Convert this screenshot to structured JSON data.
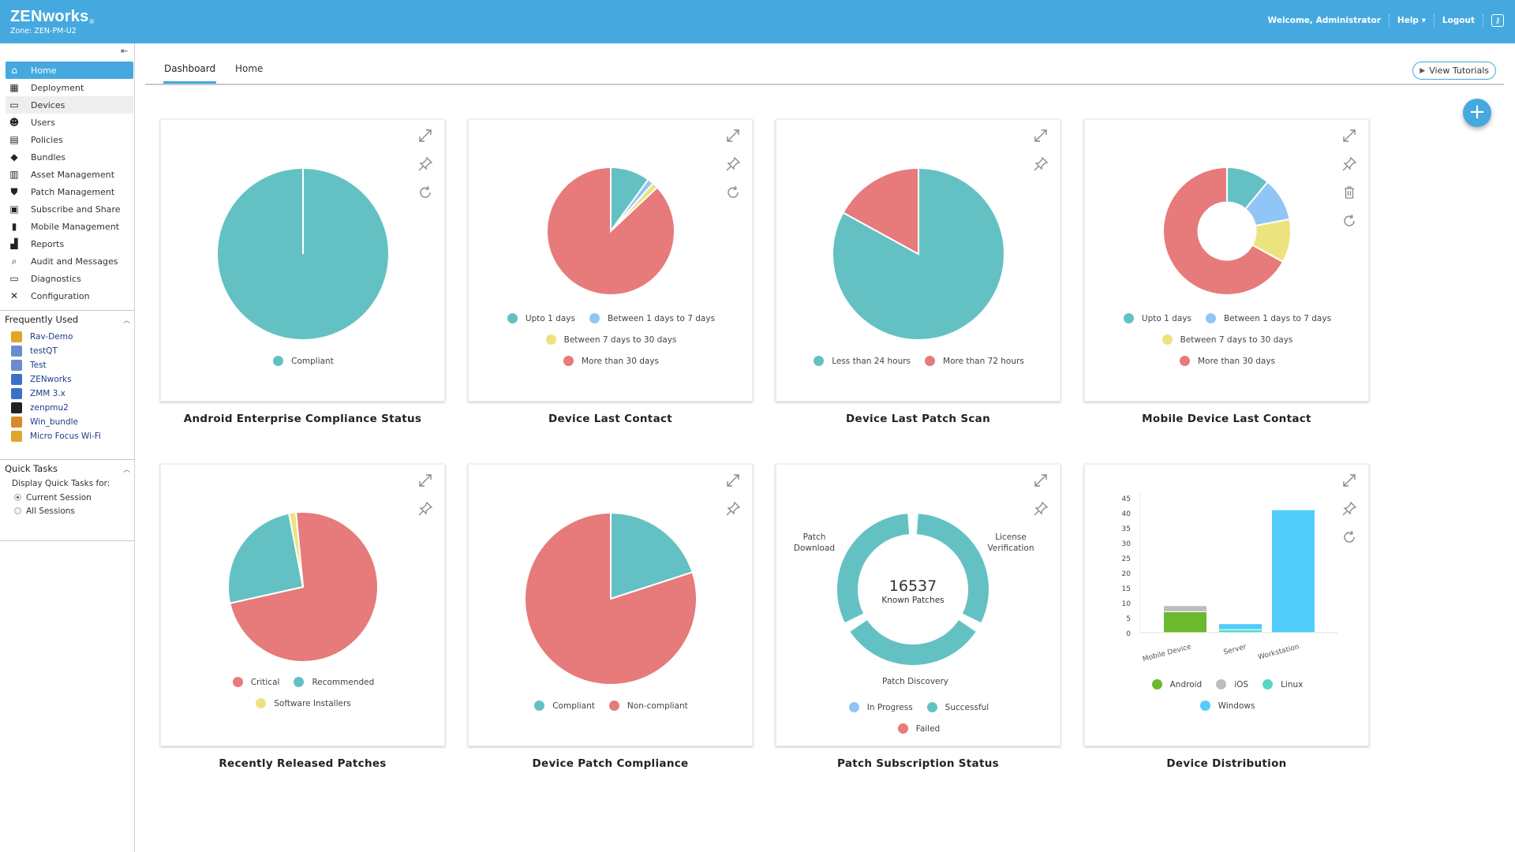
{
  "header": {
    "brand": "ZENworks",
    "brand_mark": "®",
    "zone": "Zone: ZEN-PM-U2",
    "welcome": "Welcome, Administrator",
    "help": "Help ▾",
    "logout": "Logout",
    "key_icon": "key-icon"
  },
  "sidebar": {
    "collapse_icon": "collapse-sidebar-icon",
    "items": [
      {
        "label": "Home",
        "icon": "home-icon",
        "glyph": "⌂",
        "active": true
      },
      {
        "label": "Deployment",
        "icon": "deployment-icon",
        "glyph": "▦"
      },
      {
        "label": "Devices",
        "icon": "monitor-icon",
        "glyph": "▭",
        "hover": true
      },
      {
        "label": "Users",
        "icon": "users-icon",
        "glyph": "☻"
      },
      {
        "label": "Policies",
        "icon": "policies-icon",
        "glyph": "▤"
      },
      {
        "label": "Bundles",
        "icon": "bundle-icon",
        "glyph": "◆"
      },
      {
        "label": "Asset Management",
        "icon": "asset-icon",
        "glyph": "▥"
      },
      {
        "label": "Patch Management",
        "icon": "shield-icon",
        "glyph": "⛊"
      },
      {
        "label": "Subscribe and Share",
        "icon": "subscribe-icon",
        "glyph": "▣"
      },
      {
        "label": "Mobile Management",
        "icon": "mobile-icon",
        "glyph": "▮"
      },
      {
        "label": "Reports",
        "icon": "reports-icon",
        "glyph": "▟"
      },
      {
        "label": "Audit and Messages",
        "icon": "search-icon",
        "glyph": "⌕"
      },
      {
        "label": "Diagnostics",
        "icon": "diagnostics-icon",
        "glyph": "▭"
      },
      {
        "label": "Configuration",
        "icon": "tools-icon",
        "glyph": "✕"
      }
    ],
    "frequently_used": {
      "title": "Frequently Used",
      "items": [
        {
          "label": "Rav-Demo",
          "icon": "wifi-bundle-icon",
          "color": "#e0a52a"
        },
        {
          "label": "testQT",
          "icon": "user-policy-icon",
          "color": "#6b8ccf"
        },
        {
          "label": "Test",
          "icon": "user-policy-icon",
          "color": "#6b8ccf"
        },
        {
          "label": "ZENworks",
          "icon": "mobile-bundle-icon",
          "color": "#3d6fc9"
        },
        {
          "label": "ZMM 3.x",
          "icon": "mobile-bundle-icon",
          "color": "#3d6fc9"
        },
        {
          "label": "zenpmu2",
          "icon": "server-icon",
          "color": "#222222"
        },
        {
          "label": "Win_bundle",
          "icon": "windows-bundle-icon",
          "color": "#d98b2b"
        },
        {
          "label": "Micro Focus Wi-Fi",
          "icon": "wifi-bundle-icon",
          "color": "#e0a52a"
        }
      ]
    },
    "quick_tasks": {
      "title": "Quick Tasks",
      "display_label": "Display Quick Tasks for:",
      "options": [
        {
          "label": "Current Session",
          "selected": true
        },
        {
          "label": "All Sessions",
          "selected": false
        }
      ]
    }
  },
  "tabs": [
    {
      "label": "Dashboard",
      "active": true
    },
    {
      "label": "Home",
      "active": false
    }
  ],
  "view_tutorials": "View Tutorials",
  "add_widget": "+",
  "colors": {
    "teal": "#64c1c3",
    "red": "#e77a7a",
    "blue": "#90c5f5",
    "yellow": "#ece37e",
    "green": "#6ab92e",
    "gray": "#bdbdbd",
    "linux": "#5ad6c6",
    "windows": "#52cdfb",
    "brand": "#45a9e0"
  },
  "chart_data": [
    {
      "id": "android-compliance",
      "type": "pie",
      "title": "Android Enterprise Compliance Status",
      "slices": [
        {
          "label": "Compliant",
          "value": 100,
          "color": "#64c1c3"
        }
      ],
      "legend": [
        [
          "Compliant"
        ]
      ],
      "tools": [
        "expand",
        "pin",
        "refresh"
      ]
    },
    {
      "id": "device-last-contact",
      "type": "pie",
      "title": "Device Last Contact",
      "slices": [
        {
          "label": "Upto 1 days",
          "value": 10,
          "color": "#64c1c3"
        },
        {
          "label": "Between 1 days to 7 days",
          "value": 1.5,
          "color": "#90c5f5"
        },
        {
          "label": "Between 7 days to 30 days",
          "value": 1.5,
          "color": "#ece37e"
        },
        {
          "label": "More than 30 days",
          "value": 87,
          "color": "#e77a7a"
        }
      ],
      "legend": [
        [
          "Upto 1 days",
          "Between 1 days to 7 days"
        ],
        [
          "Between 7 days to 30 days"
        ],
        [
          "More than 30 days"
        ]
      ],
      "tools": [
        "expand",
        "pin",
        "refresh"
      ]
    },
    {
      "id": "device-last-patch-scan",
      "type": "pie",
      "title": "Device Last Patch Scan",
      "slices": [
        {
          "label": "Less than 24 hours",
          "value": 83,
          "color": "#64c1c3"
        },
        {
          "label": "More than 72 hours",
          "value": 17,
          "color": "#e77a7a"
        }
      ],
      "legend": [
        [
          "Less than 24 hours",
          "More than 72 hours"
        ]
      ],
      "tools": [
        "expand",
        "pin"
      ]
    },
    {
      "id": "mobile-last-contact",
      "type": "donut",
      "title": "Mobile Device Last Contact",
      "slices": [
        {
          "label": "Upto 1 days",
          "value": 11,
          "color": "#64c1c3"
        },
        {
          "label": "Between 1 days to 7 days",
          "value": 11,
          "color": "#90c5f5"
        },
        {
          "label": "Between 7 days to 30 days",
          "value": 11,
          "color": "#ece37e"
        },
        {
          "label": "More than 30 days",
          "value": 67,
          "color": "#e77a7a"
        }
      ],
      "legend": [
        [
          "Upto 1 days",
          "Between 1 days to 7 days"
        ],
        [
          "Between 7 days to 30 days"
        ],
        [
          "More than 30 days"
        ]
      ],
      "tools": [
        "expand",
        "pin",
        "delete",
        "refresh"
      ]
    },
    {
      "id": "recently-released-patches",
      "type": "pie",
      "title": "Recently Released Patches",
      "slices": [
        {
          "label": "Critical",
          "value": 73,
          "color": "#e77a7a"
        },
        {
          "label": "Recommended",
          "value": 25.5,
          "color": "#64c1c3"
        },
        {
          "label": "Software Installers",
          "value": 1.5,
          "color": "#ece37e"
        }
      ],
      "start_offset": -1.5,
      "legend": [
        [
          "Critical",
          "Recommended"
        ],
        [
          "Software Installers"
        ]
      ],
      "tools": [
        "expand",
        "pin"
      ]
    },
    {
      "id": "device-patch-compliance",
      "type": "pie",
      "title": "Device Patch Compliance",
      "slices": [
        {
          "label": "Compliant",
          "value": 20,
          "color": "#64c1c3"
        },
        {
          "label": "Non-compliant",
          "value": 80,
          "color": "#e77a7a"
        }
      ],
      "legend": [
        [
          "Compliant",
          "Non-compliant"
        ]
      ],
      "tools": [
        "expand",
        "pin"
      ]
    },
    {
      "id": "patch-subscription-status",
      "type": "donut-segments",
      "title": "Patch Subscription Status",
      "center_value": "16537",
      "center_label": "Known Patches",
      "segments": [
        {
          "label": "License Verification",
          "status": "Successful",
          "color": "#64c1c3"
        },
        {
          "label": "Patch Discovery",
          "status": "Successful",
          "color": "#64c1c3"
        },
        {
          "label": "Patch Download",
          "status": "Successful",
          "color": "#64c1c3"
        }
      ],
      "legend_items": [
        {
          "label": "In Progress",
          "color": "#90c5f5"
        },
        {
          "label": "Successful",
          "color": "#64c1c3"
        },
        {
          "label": "Failed",
          "color": "#e77a7a"
        }
      ],
      "legend": [
        [
          "In Progress",
          "Successful"
        ],
        [
          "Failed"
        ]
      ],
      "tools": [
        "expand",
        "pin"
      ]
    },
    {
      "id": "device-distribution",
      "type": "bar",
      "stacked": true,
      "title": "Device Distribution",
      "categories": [
        "Mobile Device",
        "Server",
        "Workstation"
      ],
      "series": [
        {
          "name": "Android",
          "color": "#6ab92e",
          "values": [
            7,
            0,
            0
          ]
        },
        {
          "name": "iOS",
          "color": "#bdbdbd",
          "values": [
            2,
            0,
            0
          ]
        },
        {
          "name": "Linux",
          "color": "#5ad6c6",
          "values": [
            0,
            1,
            0
          ]
        },
        {
          "name": "Windows",
          "color": "#52cdfb",
          "values": [
            0,
            2,
            41
          ]
        }
      ],
      "ylim": [
        0,
        45
      ],
      "yticks": [
        0,
        5,
        10,
        15,
        20,
        25,
        30,
        35,
        40,
        45
      ],
      "legend": [
        [
          "Android",
          "iOS",
          "Linux"
        ],
        [
          "Windows"
        ]
      ],
      "tools": [
        "expand",
        "pin",
        "refresh"
      ]
    }
  ]
}
